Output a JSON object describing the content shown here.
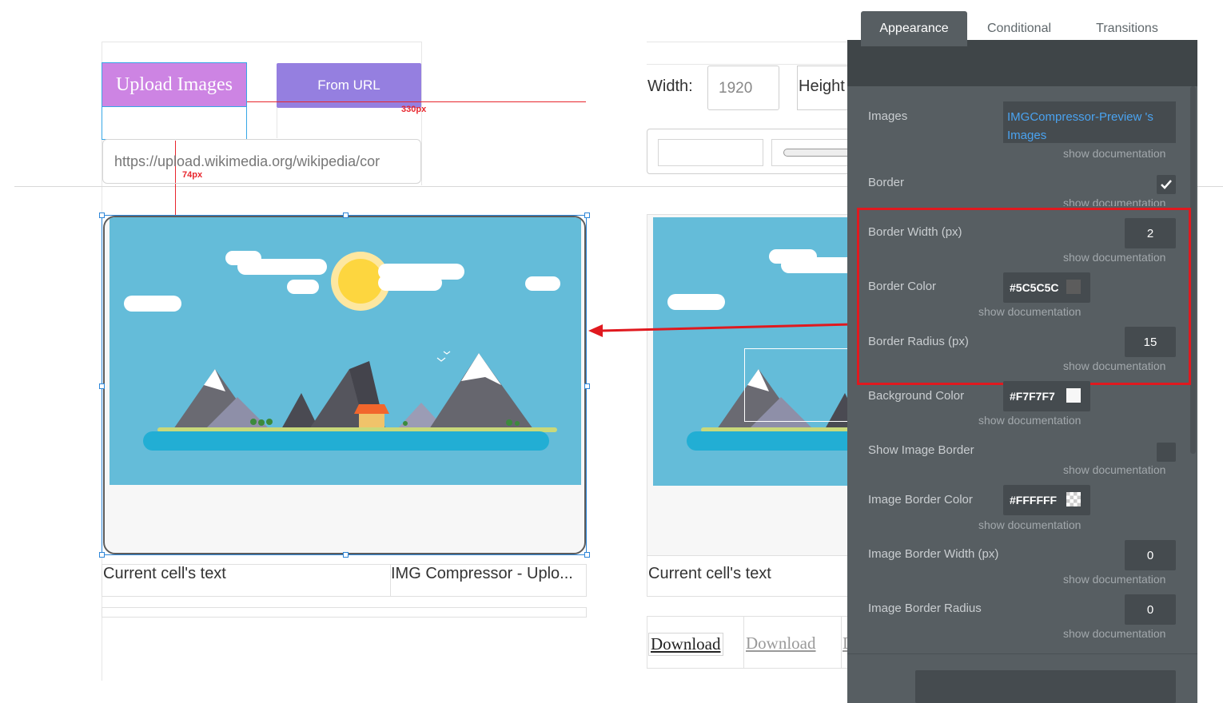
{
  "canvas": {
    "upload_button_label": "Upload Images",
    "from_url_button_label": "From URL",
    "url_input_value": "https://upload.wikimedia.org/wikipedia/cor",
    "measure_horizontal": "330px",
    "measure_vertical": "74px",
    "width_label": "Width:",
    "width_value": "1920",
    "height_label": "Height",
    "cell_text_left": "Current cell's text",
    "cell_title": "IMG Compressor - Uplo...",
    "cell_text_right": "Current cell's text",
    "download_label_1": "Download",
    "download_label_2": "Download",
    "download_label_3_partial": "D"
  },
  "panel": {
    "tabs": [
      {
        "label": "Appearance",
        "active": true
      },
      {
        "label": "Conditional",
        "active": false
      },
      {
        "label": "Transitions",
        "active": false
      }
    ],
    "show_doc": "show documentation",
    "images_label": "Images",
    "images_value": "IMGCompressor-Preview 's Images",
    "border_label": "Border",
    "border_checked": true,
    "border_width_label": "Border Width (px)",
    "border_width_value": "2",
    "border_color_label": "Border Color",
    "border_color_value": "#5C5C5C",
    "border_radius_label": "Border Radius (px)",
    "border_radius_value": "15",
    "background_color_label": "Background Color",
    "background_color_value": "#F7F7F7",
    "show_image_border_label": "Show Image Border",
    "image_border_color_label": "Image Border Color",
    "image_border_color_value": "#FFFFFF",
    "image_border_width_label": "Image Border Width (px)",
    "image_border_width_value": "0",
    "image_border_radius_label": "Image Border Radius",
    "image_border_radius_value": "0"
  },
  "colors": {
    "highlight_red": "#e0191f",
    "panel_bg": "#575e62",
    "link_blue": "#4aa3f0"
  }
}
